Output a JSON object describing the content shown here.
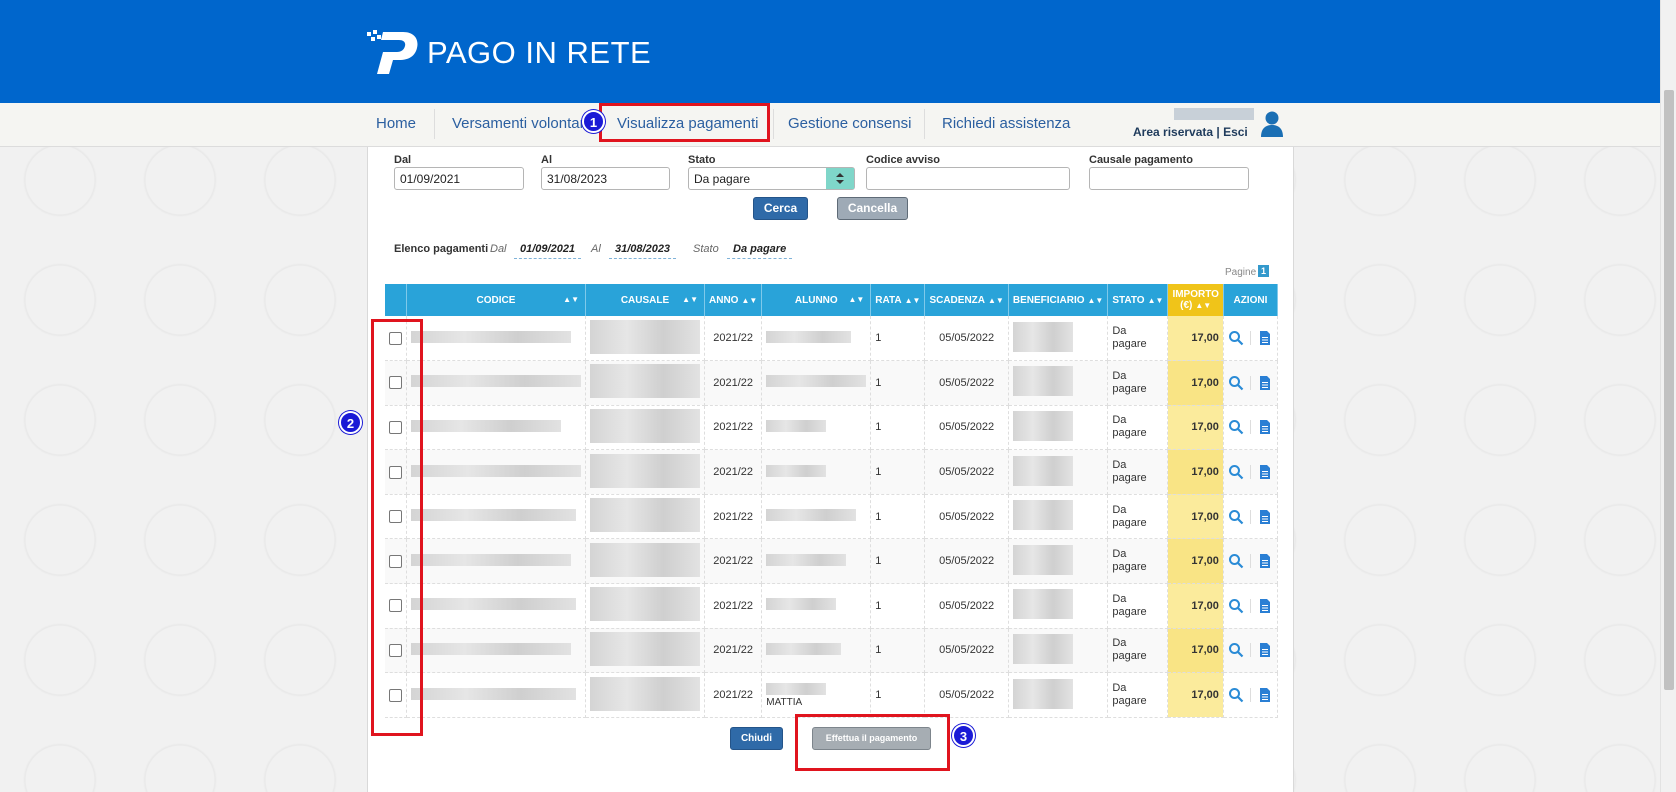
{
  "brand": {
    "logo_text": "PAGO IN RETE"
  },
  "nav": {
    "items": [
      {
        "label": "Home"
      },
      {
        "label": "Versamenti volontari"
      },
      {
        "label": "Visualizza pagamenti"
      },
      {
        "label": "Gestione consensi"
      },
      {
        "label": "Richiedi assistenza"
      }
    ],
    "area_riservata": "Area riservata | Esci"
  },
  "filters": {
    "dal_label": "Dal",
    "dal_value": "01/09/2021",
    "al_label": "Al",
    "al_value": "31/08/2023",
    "stato_label": "Stato",
    "stato_value": "Da pagare",
    "codice_label": "Codice avviso",
    "codice_value": "",
    "causale_label": "Causale pagamento",
    "causale_value": "",
    "cerca": "Cerca",
    "cancella": "Cancella"
  },
  "summary": {
    "title": "Elenco pagamenti",
    "dal_label": "Dal",
    "dal_value": "01/09/2021",
    "al_label": "Al",
    "al_value": "31/08/2023",
    "stato_label": "Stato",
    "stato_value": "Da pagare",
    "pagine_label": "Pagine",
    "pagine_value": "1"
  },
  "table": {
    "headers": [
      "CODICE",
      "CAUSALE",
      "ANNO",
      "ALUNNO",
      "RATA",
      "SCADENZA",
      "BENEFICIARIO",
      "STATO",
      "IMPORTO (€)",
      "AZIONI"
    ],
    "rows": [
      {
        "anno": "2021/22",
        "rata": "1",
        "scadenza": "05/05/2022",
        "stato": "Da pagare",
        "importo": "17,00",
        "alunno_text": ""
      },
      {
        "anno": "2021/22",
        "rata": "1",
        "scadenza": "05/05/2022",
        "stato": "Da pagare",
        "importo": "17,00",
        "alunno_text": ""
      },
      {
        "anno": "2021/22",
        "rata": "1",
        "scadenza": "05/05/2022",
        "stato": "Da pagare",
        "importo": "17,00",
        "alunno_text": ""
      },
      {
        "anno": "2021/22",
        "rata": "1",
        "scadenza": "05/05/2022",
        "stato": "Da pagare",
        "importo": "17,00",
        "alunno_text": ""
      },
      {
        "anno": "2021/22",
        "rata": "1",
        "scadenza": "05/05/2022",
        "stato": "Da pagare",
        "importo": "17,00",
        "alunno_text": ""
      },
      {
        "anno": "2021/22",
        "rata": "1",
        "scadenza": "05/05/2022",
        "stato": "Da pagare",
        "importo": "17,00",
        "alunno_text": ""
      },
      {
        "anno": "2021/22",
        "rata": "1",
        "scadenza": "05/05/2022",
        "stato": "Da pagare",
        "importo": "17,00",
        "alunno_text": ""
      },
      {
        "anno": "2021/22",
        "rata": "1",
        "scadenza": "05/05/2022",
        "stato": "Da pagare",
        "importo": "17,00",
        "alunno_text": ""
      },
      {
        "anno": "2021/22",
        "rata": "1",
        "scadenza": "05/05/2022",
        "stato": "Da pagare",
        "importo": "17,00",
        "alunno_text": "MATTIA"
      }
    ]
  },
  "footer": {
    "chiudi": "Chiudi",
    "effettua": "Effettua il pagamento"
  },
  "annotations": {
    "badge1": "1",
    "badge2": "2",
    "badge3": "3"
  },
  "colors": {
    "header_blue": "#0066cc",
    "table_header": "#29a3d9",
    "importo_bg": "#fbeb9c",
    "annotation_red": "#e0141e",
    "badge_blue": "#1a1ad6"
  }
}
